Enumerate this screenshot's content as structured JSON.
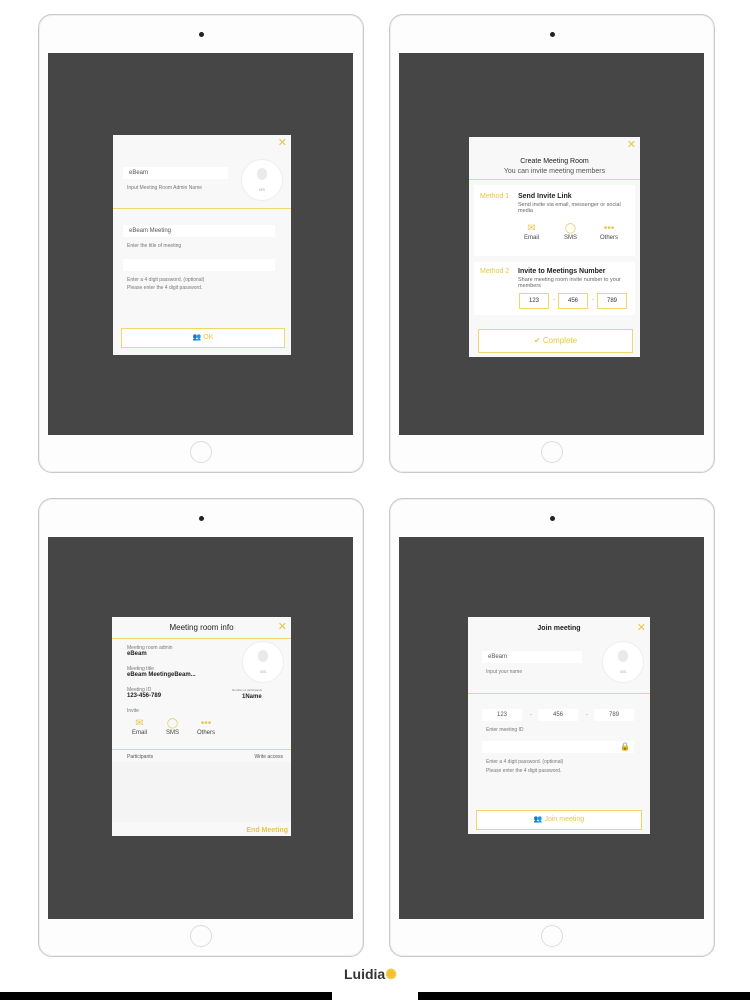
{
  "create_admin": {
    "admin_value": "eBeam",
    "admin_hint": "Input Meeting Room Admin Name",
    "avatar_caption": "GS",
    "title_value": "eBeam Meeting",
    "title_hint": "Enter the title of meeting",
    "password_hint1": "Enter a 4 digit password. (optional)",
    "password_hint2": "Please enter the 4 digit password.",
    "ok_label": "OK"
  },
  "create_room": {
    "title": "Create Meeting Room",
    "subtitle": "You can invite meeting members",
    "method1_label": "Method 1",
    "method1_title": "Send Invite Link",
    "method1_desc": "Send invite via email, messenger or social media",
    "email": "Email",
    "sms": "SMS",
    "others": "Others",
    "method2_label": "Method 2",
    "method2_title": "Invite to Meetings Number",
    "method2_desc": "Share meeting room invite number to your members",
    "num1": "123",
    "num2": "456",
    "num3": "789",
    "complete_label": "Complete"
  },
  "room_info": {
    "title": "Meeting room info",
    "admin_label": "Meeting room admin",
    "admin_value": "eBeam",
    "meeting_title_label": "Meeting title",
    "meeting_title_value": "eBeam MeetingeBeam...",
    "meeting_id_label": "Meeting ID",
    "meeting_id_value": "123-456-789",
    "count_label": "Number of participants",
    "count_value": "1Name",
    "avatar_caption": "GS",
    "invite_label": "Invite",
    "email": "Email",
    "sms": "SMS",
    "others": "Others",
    "participants_label": "Participants",
    "write_access_label": "Write access",
    "end_label": "End Meeting"
  },
  "join": {
    "title": "Join meeting",
    "name_value": "eBeam",
    "name_hint": "Input your name",
    "avatar_caption": "GS",
    "id1": "123",
    "id2": "456",
    "id3": "789",
    "id_hint": "Enter meeting ID",
    "password_hint1": "Enter a 4 digit password. (optional)",
    "password_hint2": "Please enter the 4 digit password.",
    "join_label": "Join meeting"
  },
  "brand": {
    "logo_text": "Luidia",
    "accent_color": "#e8c64a"
  }
}
